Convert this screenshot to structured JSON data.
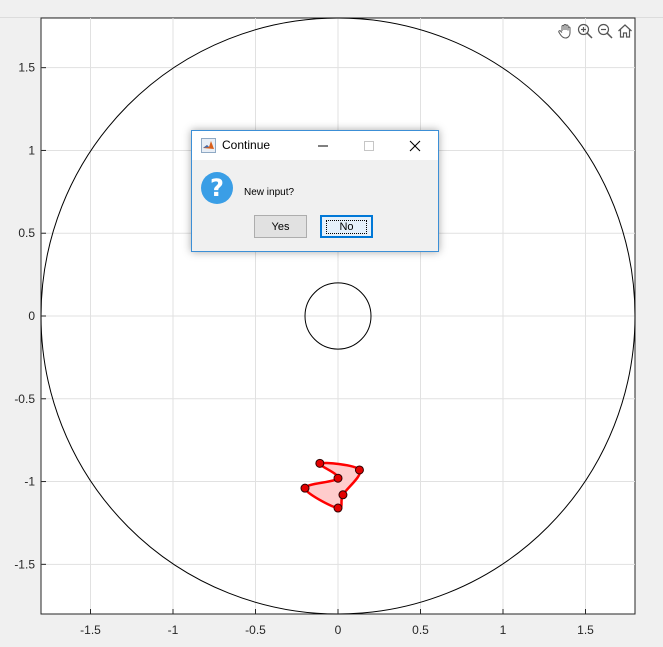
{
  "figure": {
    "axes": {
      "x_ticks": [
        "-1.5",
        "-1",
        "-0.5",
        "0",
        "0.5",
        "1",
        "1.5"
      ],
      "y_ticks": [
        "1.5",
        "1",
        "0.5",
        "0",
        "-0.5",
        "-1",
        "-1.5"
      ],
      "grid": true
    },
    "toolbar": {
      "icons": [
        "pan-icon",
        "zoom-in-icon",
        "zoom-out-icon",
        "home-icon"
      ]
    }
  },
  "chart_data": {
    "type": "scatter",
    "title": "",
    "xlabel": "",
    "ylabel": "",
    "xlim": [
      -1.8,
      1.8
    ],
    "ylim": [
      -1.8,
      1.8
    ],
    "grid": true,
    "x_ticks": [
      -1.5,
      -1,
      -0.5,
      0,
      0.5,
      1,
      1.5
    ],
    "y_ticks": [
      -1.5,
      -1,
      -0.5,
      0,
      0.5,
      1,
      1.5
    ],
    "circles": [
      {
        "cx": 0,
        "cy": 0,
        "r": 1.8,
        "color": "#000000"
      },
      {
        "cx": 0,
        "cy": 0,
        "r": 0.2,
        "color": "#000000"
      }
    ],
    "polygon": {
      "edge_color": "#ff0000",
      "fill_color": "#ffcccc",
      "points": [
        [
          -0.11,
          -0.89
        ],
        [
          0.13,
          -0.93
        ],
        [
          0.03,
          -1.08
        ],
        [
          0.0,
          -1.16
        ],
        [
          -0.2,
          -1.04
        ],
        [
          0.0,
          -0.98
        ]
      ]
    }
  },
  "dialog": {
    "title": "Continue",
    "message": "New input?",
    "buttons": {
      "yes": "Yes",
      "no": "No"
    },
    "colors": {
      "accent": "#0078d7",
      "question_icon": "#3a9ee6"
    }
  }
}
